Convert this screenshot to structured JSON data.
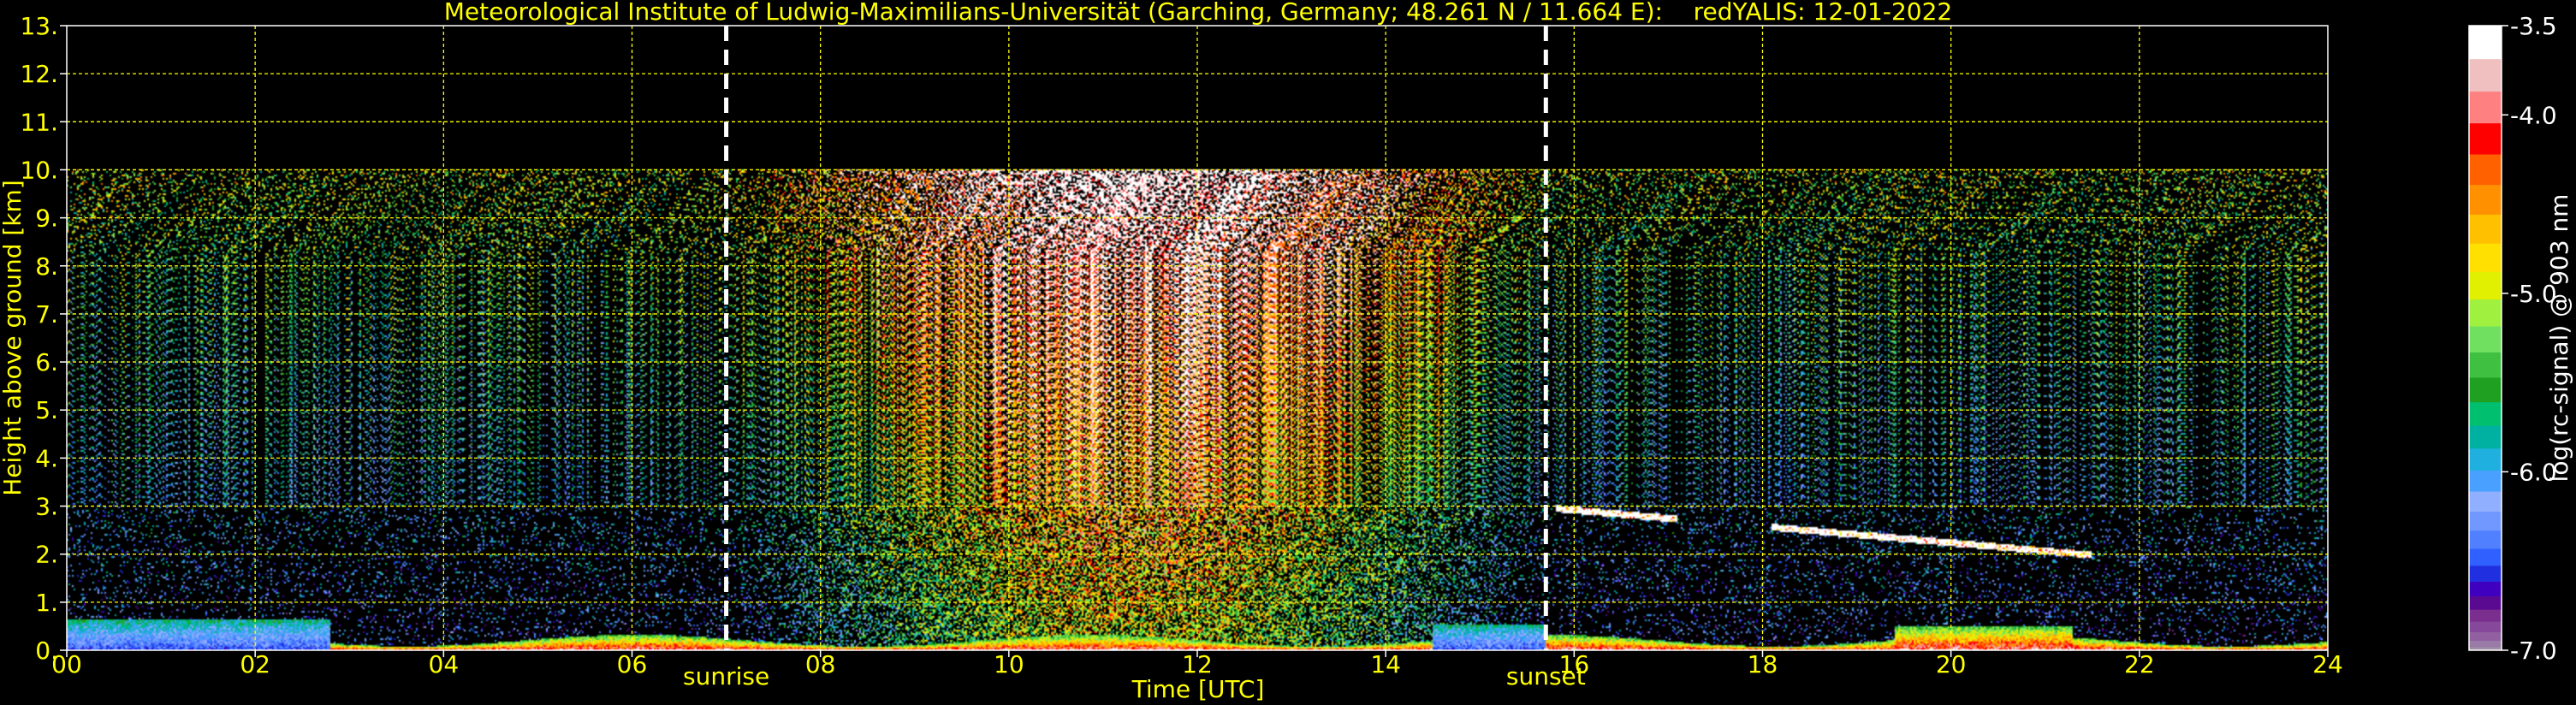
{
  "chart_data": {
    "type": "heatmap",
    "title": "Meteorological Institute of Ludwig-Maximilians-Universität (Garching, Germany; 48.261 N / 11.664 E):    redYALIS: 12-01-2022",
    "xlabel": "Time [UTC]",
    "ylabel": "Height above ground [km]",
    "xlim": [
      0,
      24
    ],
    "ylim": [
      0,
      13
    ],
    "x_ticks": [
      0,
      2,
      4,
      6,
      8,
      10,
      12,
      14,
      16,
      18,
      20,
      22,
      24
    ],
    "x_tick_labels": [
      "00",
      "02",
      "04",
      "06",
      "08",
      "10",
      "12",
      "14",
      "16",
      "18",
      "20",
      "22",
      "24"
    ],
    "y_ticks": [
      0,
      1,
      2,
      3,
      4,
      5,
      6,
      7,
      8,
      9,
      10,
      11,
      12,
      13
    ],
    "y_tick_labels": [
      "0.",
      "1.",
      "2.",
      "3.",
      "4.",
      "5.",
      "6.",
      "7.",
      "8.",
      "9.",
      "10.",
      "11.",
      "12.",
      "13."
    ],
    "grid": true,
    "grid_color": "#ffff00",
    "measurement_ceiling_km": 10,
    "annotations": [
      {
        "x": 7.0,
        "label": "sunrise"
      },
      {
        "x": 15.7,
        "label": "sunset"
      }
    ],
    "colorbar": {
      "label": "log(rc-signal) @ 903 nm",
      "range": [
        -7.0,
        -3.5
      ],
      "ticks": [
        -3.5,
        -4.0,
        -5.0,
        -6.0,
        -7.0
      ],
      "tick_labels": [
        "-3.5",
        "-4.0",
        "-5.0",
        "-6.0",
        "-7.0"
      ],
      "colors": [
        "#a090a8",
        "#9a7aa6",
        "#9060a0",
        "#85489a",
        "#7a2e8e",
        "#5a0a90",
        "#4000c0",
        "#2030e0",
        "#3060ff",
        "#5080ff",
        "#7098ff",
        "#90b0ff",
        "#4aa0ff",
        "#20b0e0",
        "#00b0a0",
        "#00c070",
        "#20a020",
        "#40c040",
        "#70e060",
        "#a0f040",
        "#e0f000",
        "#ffe000",
        "#ffc000",
        "#ff9000",
        "#ff6000",
        "#ff0000",
        "#ff8080",
        "#f0c0c0",
        "#ffffff"
      ]
    },
    "layers": [
      {
        "name": "noise",
        "x_range": [
          0,
          24
        ],
        "y_range": [
          0,
          10
        ]
      },
      {
        "name": "boundary_layer",
        "x_range": [
          0,
          24
        ],
        "y_range": [
          0,
          0.7
        ]
      },
      {
        "name": "cloud_layer",
        "x_range": [
          15.8,
          21.5
        ],
        "y_range": [
          1.9,
          3.0
        ]
      }
    ]
  }
}
